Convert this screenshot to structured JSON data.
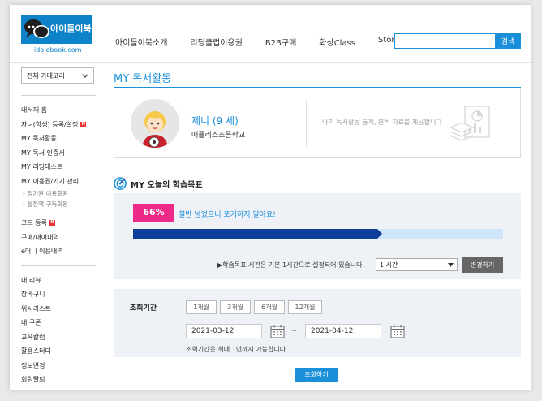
{
  "header": {
    "logo_text": "아이들이북",
    "logo_url": "idolebook.com",
    "nav": [
      "아이들이북소개",
      "리딩클럽이용권",
      "B2B구매",
      "화상Class",
      "Store"
    ],
    "search": {
      "placeholder": "",
      "button_label": "검색"
    }
  },
  "sidebar": {
    "category_select": "전체 카테고리",
    "group1": [
      {
        "label": "내서재 홈",
        "new": false
      },
      {
        "label": "자녀(학생) 등록/설정",
        "new": true
      },
      {
        "label": "MY 독서활동",
        "new": false
      },
      {
        "label": "MY 독서 인증서",
        "new": false
      },
      {
        "label": "MY 리딩테스트",
        "new": false
      },
      {
        "label": "MY 이용권/기기 관리",
        "new": false
      }
    ],
    "subitems": [
      "› 정기권 이용회원",
      "› 월정액 구독회원"
    ],
    "group1b": [
      {
        "label": "코드 등록",
        "new": true
      },
      {
        "label": "구매/대여내역",
        "new": false
      },
      {
        "label": "e머니 이용내역",
        "new": false
      }
    ],
    "group2": [
      "내 리뷰",
      "장바구니",
      "위시리스트",
      "내 쿠폰",
      "교육칼럼",
      "활용스터디",
      "정보변경",
      "회원탈퇴"
    ],
    "new_badge": "N"
  },
  "main": {
    "title": "MY 독서활동",
    "profile": {
      "name": "제니 (9 세)",
      "school": "애플리스초등학교",
      "description": "나의 독서활동 통계, 분석 자료를 제공합니다"
    },
    "goal": {
      "title": "MY 오늘의 학습목표",
      "percent_label": "66%",
      "progress": 0.66,
      "message": "절반 넘었으니 포기하지 말아요!",
      "note": "▶학습목표 시간은 기본 1시간으로 설정되어 있습니다.",
      "time_value": "1 시간",
      "change_button": "변경하기"
    },
    "period": {
      "label": "조회기간",
      "buttons": [
        "1개월",
        "3개월",
        "6개월",
        "12개월"
      ],
      "start_date": "2021-03-12",
      "separator": "~",
      "end_date": "2021-04-12",
      "note": "조회기간은 최대 1년까지 가능합니다."
    },
    "submit_label": "조회하기"
  },
  "colors": {
    "accent": "#1a8fd9",
    "badge": "#ee2a88",
    "progress": "#0e3c9a",
    "panel": "#eef1f5"
  }
}
